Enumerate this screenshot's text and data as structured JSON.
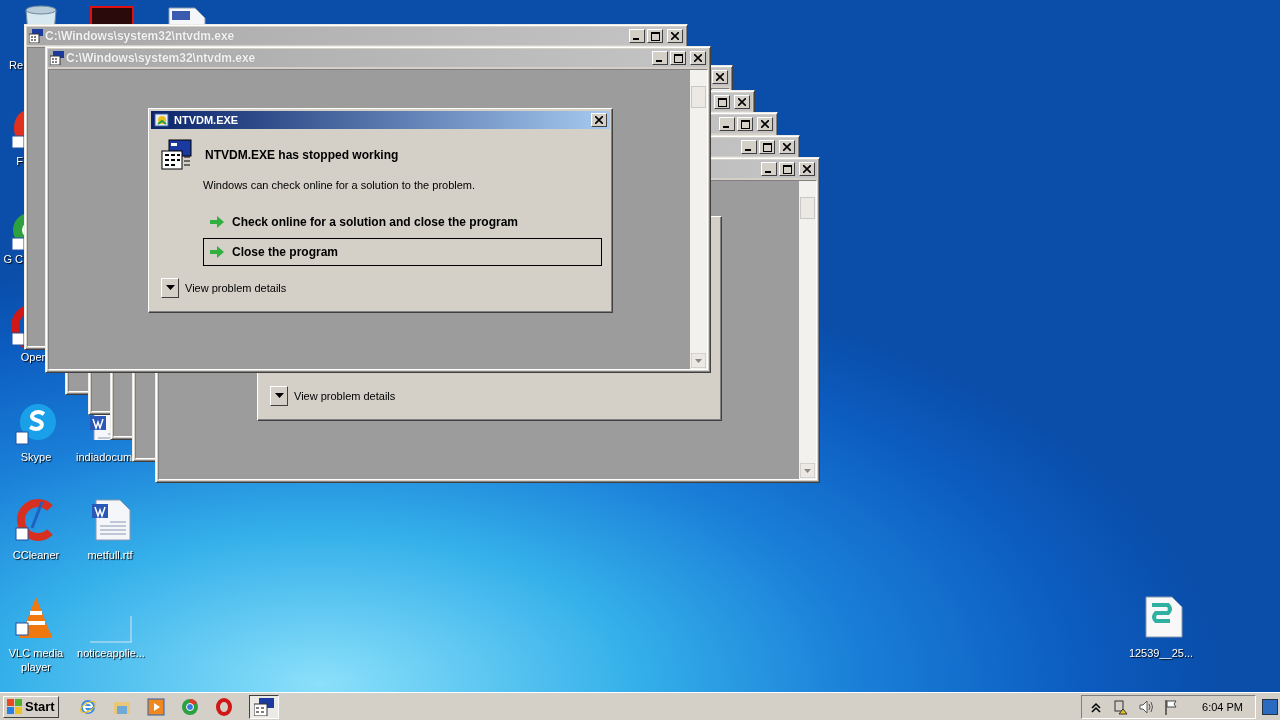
{
  "desktop_icons": [
    {
      "kind": "recycle_bin",
      "label": "Re"
    },
    {
      "kind": "red_app"
    },
    {
      "kind": "document"
    },
    {
      "kind": "red_round",
      "label": "F"
    },
    {
      "kind": "chrome",
      "label": "G C"
    },
    {
      "kind": "opera",
      "label": "Oper"
    },
    {
      "kind": "skype",
      "label": "Skype"
    },
    {
      "kind": "word_doc",
      "label": "indiadocum"
    },
    {
      "kind": "ccleaner",
      "label": "CCleaner"
    },
    {
      "kind": "word_doc",
      "label": "metfull.rtf"
    },
    {
      "kind": "vlc",
      "label": "VLC media player"
    },
    {
      "kind": "blank",
      "label": "noticeapplie..."
    },
    {
      "kind": "script",
      "label": "12539__25..."
    }
  ],
  "background_windows": [
    {
      "kind": "console"
    },
    {
      "kind": "console"
    },
    {
      "kind": "console"
    },
    {
      "kind": "console"
    },
    {
      "kind": "console",
      "dialog": {
        "details_label": "View problem details"
      }
    }
  ],
  "windows": [
    {
      "kind": "console",
      "title": "C:\\Windows\\system32\\ntvdm.exe"
    },
    {
      "kind": "console",
      "title": "C:\\Windows\\system32\\ntvdm.exe"
    }
  ],
  "dialog": {
    "title": "NTVDM.EXE",
    "heading": "NTVDM.EXE has stopped working",
    "message": "Windows can check online for a solution to the problem.",
    "options": [
      {
        "label": "Check online for a solution and close the program",
        "selected": false
      },
      {
        "label": "Close the program",
        "selected": true
      }
    ],
    "details_label": "View problem details"
  },
  "taskbar": {
    "start_label": "Start",
    "quick_launch": [
      {
        "kind": "ie"
      },
      {
        "kind": "folder"
      },
      {
        "kind": "media"
      },
      {
        "kind": "chrome"
      },
      {
        "kind": "opera"
      }
    ],
    "tasks": [
      {
        "kind": "console",
        "selected": true
      }
    ],
    "tray": [
      {
        "kind": "chevron"
      },
      {
        "kind": "network"
      },
      {
        "kind": "volume"
      },
      {
        "kind": "flag"
      }
    ],
    "clock": "6:04 PM"
  }
}
